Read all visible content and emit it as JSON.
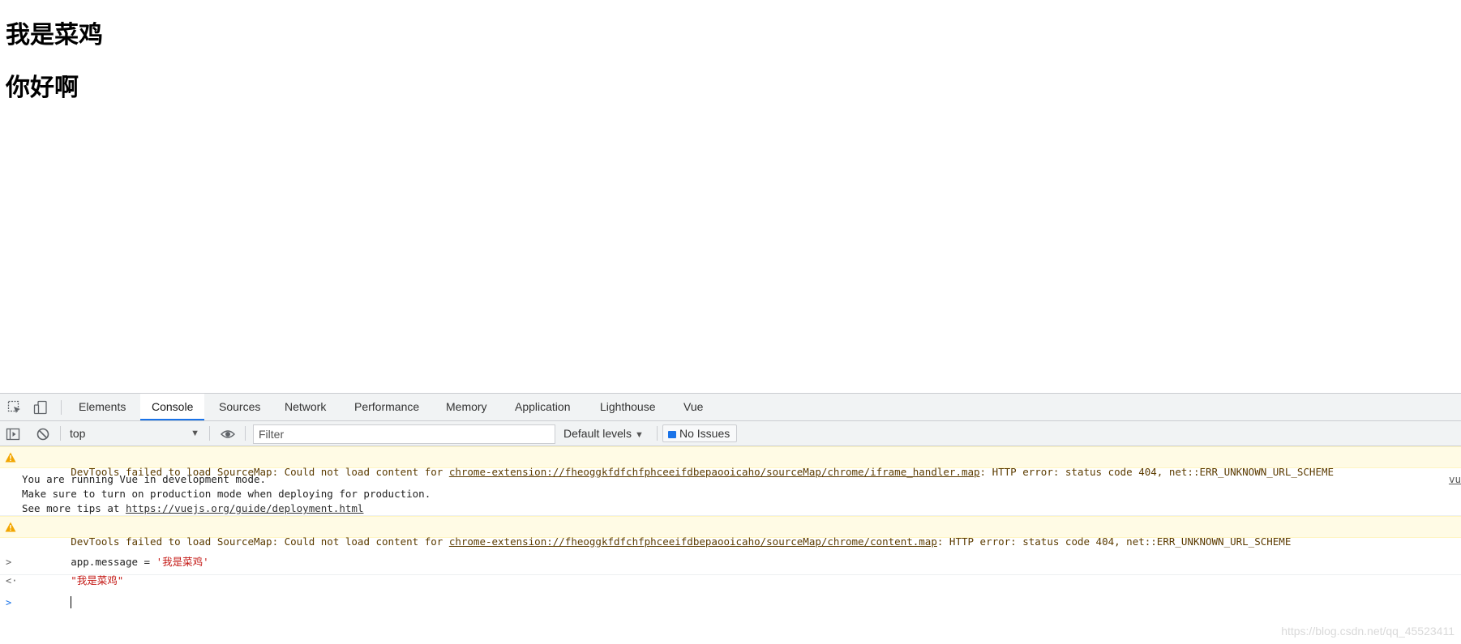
{
  "page": {
    "heading_1": "我是菜鸡",
    "heading_2": "你好啊"
  },
  "devtools": {
    "tabs": [
      {
        "label": "Elements",
        "active": false
      },
      {
        "label": "Console",
        "active": true
      },
      {
        "label": "Sources",
        "active": false
      },
      {
        "label": "Network",
        "active": false
      },
      {
        "label": "Performance",
        "active": false
      },
      {
        "label": "Memory",
        "active": false
      },
      {
        "label": "Application",
        "active": false
      },
      {
        "label": "Lighthouse",
        "active": false
      },
      {
        "label": "Vue",
        "active": false
      }
    ],
    "toolbar": {
      "context": "top",
      "filter_placeholder": "Filter",
      "levels": "Default levels",
      "issues": "No Issues"
    },
    "console": {
      "warning_1": {
        "prefix": "DevTools failed to load SourceMap: Could not load content for ",
        "link": "chrome-extension://fheoggkfdfchfphceeifdbepaooicaho/sourceMap/chrome/iframe_handler.map",
        "suffix": ": HTTP error: status code 404, net::ERR_UNKNOWN_URL_SCHEME"
      },
      "info": {
        "line_1": "You are running Vue in development mode.",
        "line_2": "Make sure to turn on production mode when deploying for production.",
        "line_3_prefix": "See more tips at ",
        "line_3_link": "https://vuejs.org/guide/deployment.html",
        "source": "vu"
      },
      "warning_2": {
        "prefix": "DevTools failed to load SourceMap: Could not load content for ",
        "link": "chrome-extension://fheoggkfdfchfphceeifdbepaooicaho/sourceMap/chrome/content.map",
        "suffix": ": HTTP error: status code 404, net::ERR_UNKNOWN_URL_SCHEME"
      },
      "command": {
        "code": "app.message = ",
        "string": "'我是菜鸡'"
      },
      "result": "\"我是菜鸡\""
    },
    "colors": {
      "active_tab_underline": "#1a73e8",
      "warning_bg": "#fffbe5",
      "warning_text": "#5c3c00",
      "string_red": "#c41a16"
    }
  },
  "watermark": "https://blog.csdn.net/qq_45523411"
}
